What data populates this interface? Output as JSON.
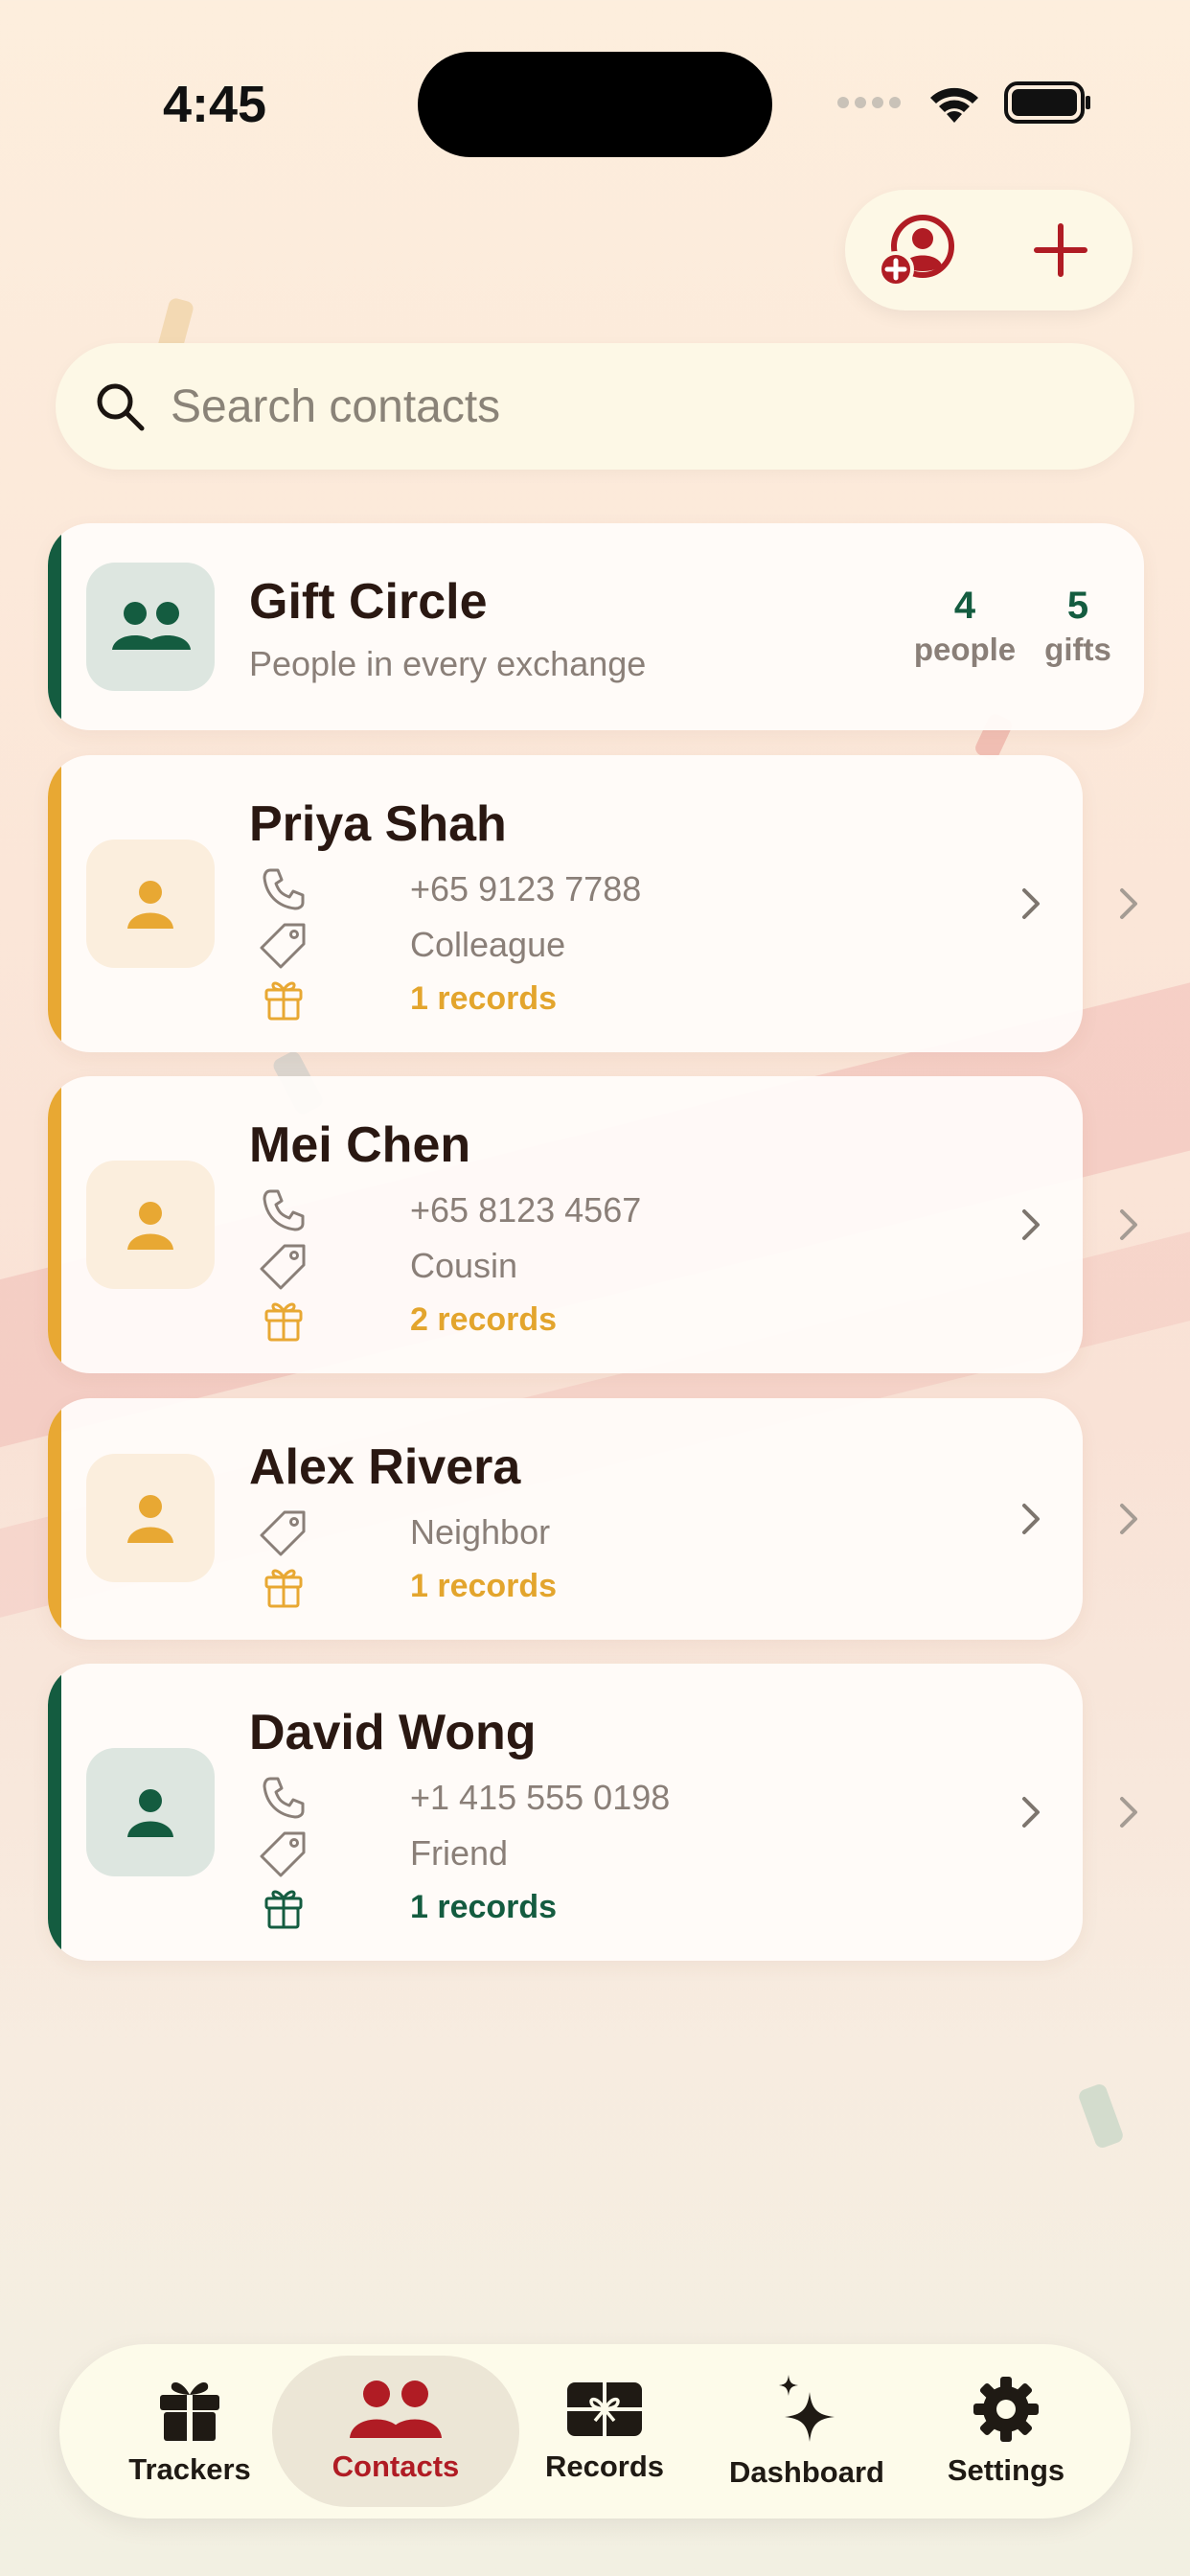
{
  "status": {
    "time": "4:45"
  },
  "search": {
    "placeholder": "Search contacts"
  },
  "header_actions": {
    "add_contact_icon": "person-plus-icon",
    "add_icon": "plus-icon"
  },
  "summary": {
    "title": "Gift Circle",
    "subtitle": "People in every exchange",
    "people_count": "4",
    "people_label": "people",
    "gifts_count": "5",
    "gifts_label": "gifts"
  },
  "contacts": [
    {
      "name": "Priya Shah",
      "phone": "+65 9123 7788",
      "relation": "Colleague",
      "records": "1 records",
      "color": "#e8a833"
    },
    {
      "name": "Mei Chen",
      "phone": "+65 8123 4567",
      "relation": "Cousin",
      "records": "2 records",
      "color": "#e8a833"
    },
    {
      "name": "Alex Rivera",
      "relation": "Neighbor",
      "records": "1 records",
      "color": "#e8a833"
    },
    {
      "name": "David Wong",
      "phone": "+1 415 555 0198",
      "relation": "Friend",
      "records": "1 records",
      "color": "#145c40"
    }
  ],
  "tabs": [
    {
      "label": "Trackers",
      "icon": "gift-icon"
    },
    {
      "label": "Contacts",
      "icon": "people-icon",
      "active": true
    },
    {
      "label": "Records",
      "icon": "gift-card-icon"
    },
    {
      "label": "Dashboard",
      "icon": "sparkles-icon"
    },
    {
      "label": "Settings",
      "icon": "gear-icon"
    }
  ],
  "colors": {
    "brand_red": "#b01c24",
    "accent_green": "#145c40",
    "accent_gold": "#e8a833"
  }
}
